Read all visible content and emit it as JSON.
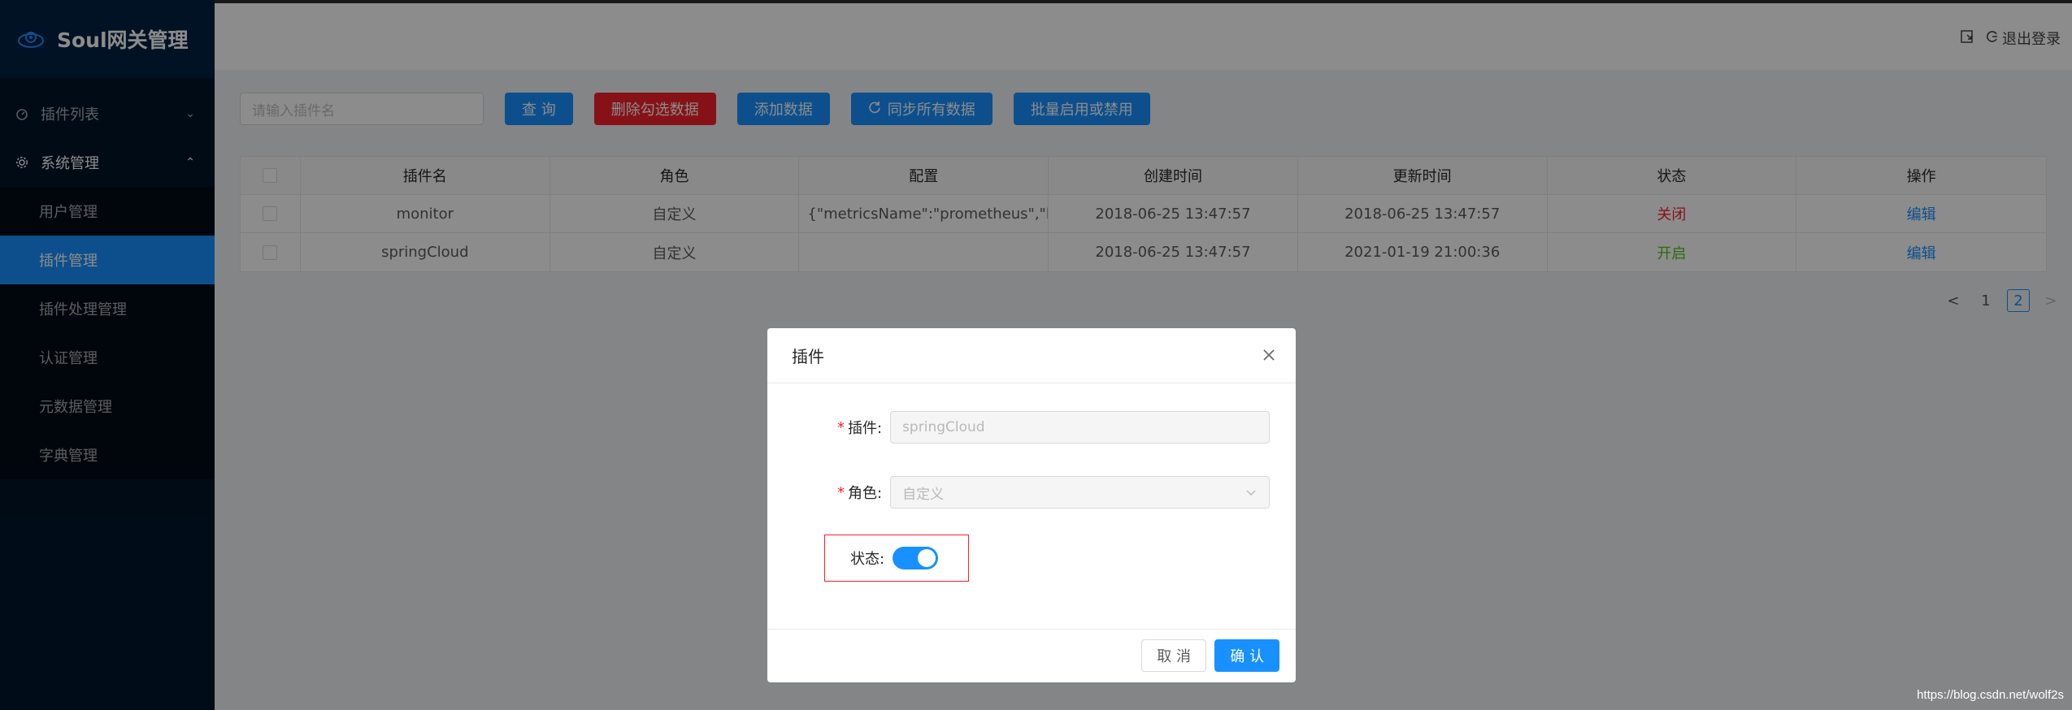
{
  "app": {
    "title": "Soul网关管理"
  },
  "sidebar": {
    "groups": [
      {
        "label": "插件列表",
        "open": false
      },
      {
        "label": "系统管理",
        "open": true
      }
    ],
    "system_items": [
      {
        "label": "用户管理"
      },
      {
        "label": "插件管理",
        "active": true
      },
      {
        "label": "插件处理管理"
      },
      {
        "label": "认证管理"
      },
      {
        "label": "元数据管理"
      },
      {
        "label": "字典管理"
      }
    ]
  },
  "header": {
    "logout_label": "退出登录"
  },
  "toolbar": {
    "search_placeholder": "请输入插件名",
    "query": "查 询",
    "delete_selected": "删除勾选数据",
    "add": "添加数据",
    "sync_all": "同步所有数据",
    "batch_toggle": "批量启用或禁用"
  },
  "table": {
    "headers": [
      "插件名",
      "角色",
      "配置",
      "创建时间",
      "更新时间",
      "状态",
      "操作"
    ],
    "rows": [
      {
        "name": "monitor",
        "role": "自定义",
        "config": "{\"metricsName\":\"prometheus\",\"hos...",
        "created": "2018-06-25 13:47:57",
        "updated": "2018-06-25 13:47:57",
        "status": "关闭",
        "action": "编辑"
      },
      {
        "name": "springCloud",
        "role": "自定义",
        "config": "",
        "created": "2018-06-25 13:47:57",
        "updated": "2021-01-19 21:00:36",
        "status": "开启",
        "action": "编辑"
      }
    ]
  },
  "pagination": {
    "prev": "<",
    "pages": [
      "1",
      "2"
    ],
    "current": "2",
    "next": ">"
  },
  "modal": {
    "title": "插件",
    "plugin_label": "插件:",
    "plugin_value": "springCloud",
    "role_label": "角色:",
    "role_value": "自定义",
    "status_label": "状态:",
    "status_on": true,
    "cancel": "取 消",
    "ok": "确 认"
  },
  "watermark": "https://blog.csdn.net/wolf2s",
  "colors": {
    "primary": "#1890ff",
    "danger": "#f5222d",
    "success": "#52c41a",
    "sidebar": "#001529"
  }
}
